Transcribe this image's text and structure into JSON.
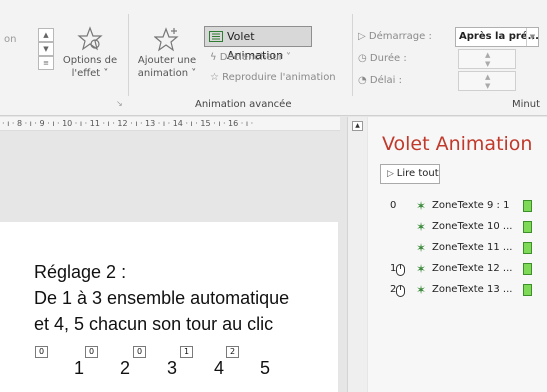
{
  "ribbon": {
    "left_cut_label": "on",
    "options_effet_line1": "Options de",
    "options_effet_line2": "l'effet ˅",
    "ajouter_line1": "Ajouter une",
    "ajouter_line2": "animation ˅",
    "volet_animation": "Volet Animation",
    "declencheur": "Déclencheur ˅",
    "reproduire": "Reproduire l'animation",
    "group_label": "Animation avancée",
    "demarrage_label": "Démarrage :",
    "demarrage_value": "Après la pré...",
    "duree_label": "Durée :",
    "delai_label": "Délai :",
    "minutage_cut": "Minut"
  },
  "ruler": {
    "text": "· ı · 8 · ı · 9 · ı · 10 · ı · 11 · ı · 12 · ı · 13 · ı · 14 · ı · 15 · ı · 16 · ı ·"
  },
  "slide": {
    "line1": "Réglage 2 :",
    "line2": "De 1 à 3 ensemble automatique",
    "line3": "et 4,  5  chacun son tour au clic",
    "tags": [
      "0",
      "0",
      "0",
      "1",
      "2"
    ],
    "numbers": [
      "1",
      "2",
      "3",
      "4",
      "5"
    ]
  },
  "pane": {
    "title": "Volet Animation",
    "play_all": "Lire tout",
    "items": [
      {
        "index": "0",
        "label": "ZoneTexte 9 : 1",
        "trigger": "none"
      },
      {
        "index": "",
        "label": "ZoneTexte 10 ...",
        "trigger": "none"
      },
      {
        "index": "",
        "label": "ZoneTexte 11 ...",
        "trigger": "none"
      },
      {
        "index": "1",
        "label": "ZoneTexte 12 ...",
        "trigger": "mouse"
      },
      {
        "index": "2",
        "label": "ZoneTexte 13 ...",
        "trigger": "mouse"
      }
    ]
  },
  "colors": {
    "pane_title": "#c0392b",
    "effect_bar": "#7ed957",
    "effect_star": "#3b8a3b"
  }
}
